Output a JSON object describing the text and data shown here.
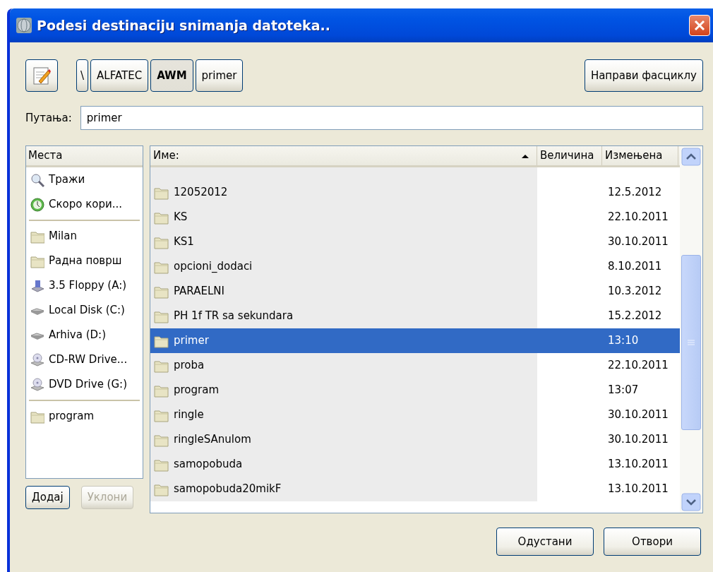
{
  "window": {
    "title": "Podesi destinaciju snimanja datoteka.."
  },
  "toolbar": {
    "path_buttons": [
      {
        "label": "\\",
        "selected": false
      },
      {
        "label": "ALFATEC",
        "selected": false
      },
      {
        "label": "AWM",
        "selected": true
      },
      {
        "label": "primer",
        "selected": false
      }
    ],
    "new_folder_button": "Направи фасциклу"
  },
  "location": {
    "label": "Путања:",
    "value": "primer"
  },
  "places": {
    "header": "Места",
    "sections": [
      {
        "items": [
          {
            "kind": "search",
            "label": "Тражи"
          },
          {
            "kind": "recent",
            "label": "Скоро кори..."
          }
        ]
      },
      {
        "items": [
          {
            "kind": "folder",
            "label": "Milan"
          },
          {
            "kind": "folder",
            "label": "Радна површ"
          },
          {
            "kind": "floppy",
            "label": "3.5 Floppy (A:)"
          },
          {
            "kind": "disk",
            "label": "Local Disk (C:)"
          },
          {
            "kind": "disk",
            "label": "Arhiva (D:)"
          },
          {
            "kind": "cdrom",
            "label": "CD-RW Drive..."
          },
          {
            "kind": "cdrom",
            "label": "DVD Drive (G:)"
          }
        ]
      },
      {
        "items": [
          {
            "kind": "folder",
            "label": "program"
          }
        ]
      }
    ]
  },
  "add_button": {
    "label": "Додај",
    "disabled": false
  },
  "remove_button": {
    "label": "Уклони",
    "disabled": true
  },
  "files": {
    "columns": [
      "Име:",
      "Величина",
      "Измењена"
    ],
    "rows": [
      {
        "name": "12052012",
        "modified": "12.5.2012",
        "selected": false
      },
      {
        "name": "KS",
        "modified": "22.10.2011",
        "selected": false
      },
      {
        "name": "KS1",
        "modified": "30.10.2011",
        "selected": false
      },
      {
        "name": "opcioni_dodaci",
        "modified": "8.10.2011",
        "selected": false
      },
      {
        "name": "PARAELNI",
        "modified": "10.3.2012",
        "selected": false
      },
      {
        "name": "PH 1f TR sa sekundara",
        "modified": "15.2.2012",
        "selected": false
      },
      {
        "name": "primer",
        "modified": "13:10",
        "selected": true
      },
      {
        "name": "proba",
        "modified": "22.10.2011",
        "selected": false
      },
      {
        "name": "program",
        "modified": "13:07",
        "selected": false
      },
      {
        "name": "ringle",
        "modified": "30.10.2011",
        "selected": false
      },
      {
        "name": "ringleSAnulom",
        "modified": "30.10.2011",
        "selected": false
      },
      {
        "name": "samopobuda",
        "modified": "13.10.2011",
        "selected": false
      },
      {
        "name": "samopobuda20mikF",
        "modified": "13.10.2011",
        "selected": false
      }
    ]
  },
  "buttons": [
    {
      "label": "Одустани"
    },
    {
      "label": "Отвори"
    }
  ]
}
